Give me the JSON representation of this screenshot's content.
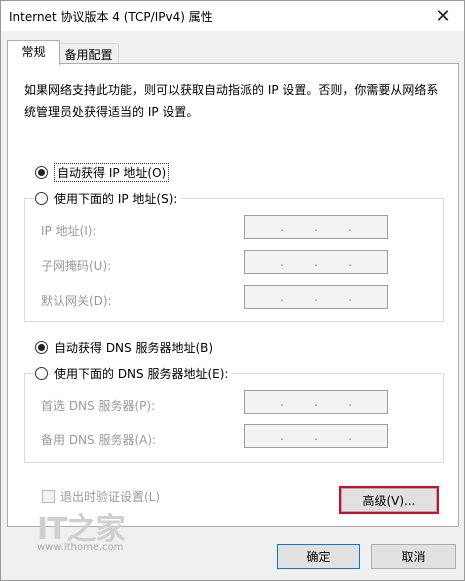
{
  "window": {
    "title": "Internet 协议版本 4 (TCP/IPv4) 属性",
    "close_glyph": "✕"
  },
  "tabs": [
    {
      "label": "常规",
      "active": true
    },
    {
      "label": "备用配置",
      "active": false
    }
  ],
  "description": "如果网络支持此功能，则可以获取自动指派的 IP 设置。否则，你需要从网络系统管理员处获得适当的 IP 设置。",
  "ip_section": {
    "auto_label": "自动获得 IP 地址(O)",
    "auto_selected": true,
    "manual_label": "使用下面的 IP 地址(S):",
    "fields": [
      {
        "label": "IP 地址(I):",
        "value": ".   .   ."
      },
      {
        "label": "子网掩码(U):",
        "value": ".   .   ."
      },
      {
        "label": "默认网关(D):",
        "value": ".   .   ."
      }
    ]
  },
  "dns_section": {
    "auto_label": "自动获得 DNS 服务器地址(B)",
    "auto_selected": true,
    "manual_label": "使用下面的 DNS 服务器地址(E):",
    "fields": [
      {
        "label": "首选 DNS 服务器(P):",
        "value": ".   .   ."
      },
      {
        "label": "备用 DNS 服务器(A):",
        "value": ".   .   ."
      }
    ]
  },
  "validate_on_exit": {
    "label": "退出时验证设置(L)",
    "checked": false,
    "enabled": false
  },
  "buttons": {
    "advanced": "高级(V)...",
    "ok": "确定",
    "cancel": "取消"
  },
  "watermark": {
    "logo": "IT之家",
    "url": "www.ithome.com"
  },
  "colors": {
    "highlight_border": "#c8102e",
    "default_button_border": "#0078d7",
    "disabled_text": "#9a9a9a"
  }
}
